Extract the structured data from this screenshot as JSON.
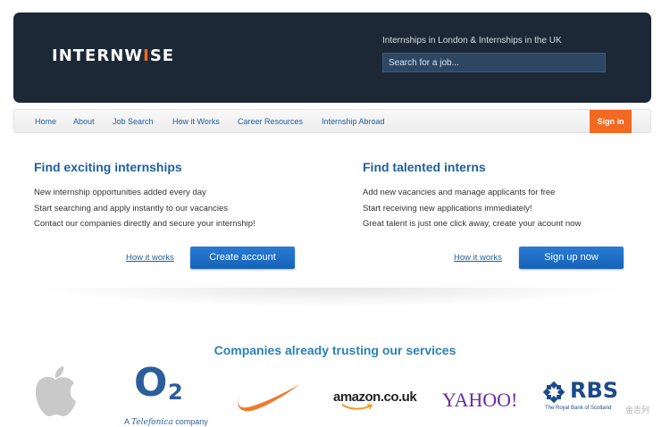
{
  "header": {
    "logo_text_1": "INTERNW",
    "logo_text_2": "I",
    "logo_text_3": "SE",
    "tagline": "Internships in London & Internships in the UK",
    "search_placeholder": "Search for a job..."
  },
  "nav": {
    "items": [
      "Home",
      "About",
      "Job Search",
      "How it Works",
      "Career Resources",
      "Internship Abroad"
    ],
    "signin_label": "Sign in"
  },
  "left_panel": {
    "title": "Find exciting internships",
    "lines": [
      "New internship opportunities added every day",
      "Start searching and apply instantly to our vacancies",
      "Contact our companies directly and secure your internship!"
    ],
    "link": "How it works",
    "button": "Create account"
  },
  "right_panel": {
    "title": "Find talented interns",
    "lines": [
      "Add new vacancies and manage applicants for free",
      "Start receiving new applications immediately!",
      "Great talent is just one click away, create your acount now"
    ],
    "link": "How it works",
    "button": "Sign up now"
  },
  "companies": {
    "title": "Companies already trusting our services",
    "o2_mark": "O",
    "o2_sub": "2",
    "o2_tagline_1": "A ",
    "o2_tagline_brand": "Telefonica",
    "o2_tagline_2": " company",
    "amazon": "amazon.co.uk",
    "yahoo": "YAHOO!",
    "rbs": "RBS",
    "rbs_tagline": "The Royal Bank of Scotland"
  },
  "watermark": "金吉列",
  "colors": {
    "header_bg": "#1c2836",
    "accent_orange": "#f26a22",
    "link_blue": "#1f5fa0",
    "button_blue": "#1a6dc7"
  }
}
